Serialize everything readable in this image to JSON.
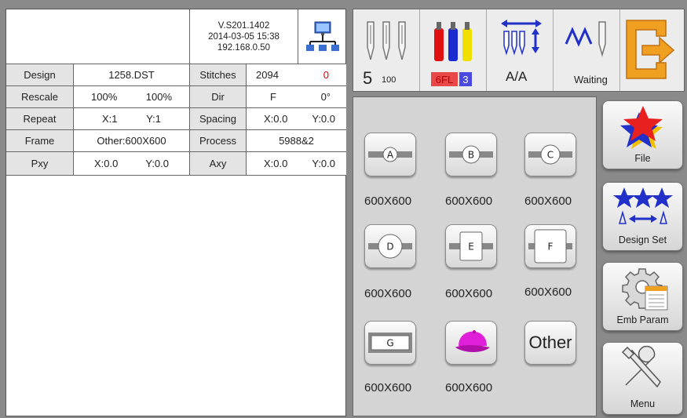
{
  "info": {
    "version": "V.S201.1402",
    "datetime": "2014-03-05 15:38",
    "ip": "192.168.0.50"
  },
  "table": {
    "design_label": "Design",
    "design_value": "1258.DST",
    "stitches_label": "Stitches",
    "stitches_value": "2094",
    "stitches_extra": "0",
    "rescale_label": "Rescale",
    "rescale_x": "100%",
    "rescale_y": "100%",
    "dir_label": "Dir",
    "dir_value": "F",
    "dir_angle": "0°",
    "repeat_label": "Repeat",
    "repeat_x": "X:1",
    "repeat_y": "Y:1",
    "spacing_label": "Spacing",
    "spacing_x": "X:0.0",
    "spacing_y": "Y:0.0",
    "frame_label": "Frame",
    "frame_value": "Other:600X600",
    "process_label": "Process",
    "process_value": "5988&2",
    "pxy_label": "Pxy",
    "pxy_x": "X:0.0",
    "pxy_y": "Y:0.0",
    "axy_label": "Axy",
    "axy_x": "X:0.0",
    "axy_y": "Y:0.0"
  },
  "status": {
    "needle_number": "5",
    "needle_speed": "100",
    "color_code": "6FL",
    "color_index": "3",
    "mode": "A/A",
    "state": "Waiting"
  },
  "frames": [
    {
      "id": "A",
      "size": "600X600"
    },
    {
      "id": "B",
      "size": "600X600"
    },
    {
      "id": "C",
      "size": "600X600"
    },
    {
      "id": "D",
      "size": "600X600"
    },
    {
      "id": "E",
      "size": "600X600"
    },
    {
      "id": "F",
      "size": "600X600"
    },
    {
      "id": "G",
      "size": "600X600"
    },
    {
      "id": "cap",
      "size": "600X600"
    },
    {
      "id": "other",
      "label": "Other"
    }
  ],
  "side": {
    "file": "File",
    "design_set": "Design Set",
    "emb_param": "Emb Param",
    "menu": "Menu"
  },
  "colors": {
    "thread_red": "#e01010",
    "thread_blue": "#1a2ad0",
    "thread_yellow": "#f0e000",
    "icon_blue": "#2030c8",
    "cap_magenta": "#e020d8",
    "exit_orange": "#f0a020",
    "color_code_bg": "#e84848",
    "color_index_bg": "#4a4ae0"
  }
}
